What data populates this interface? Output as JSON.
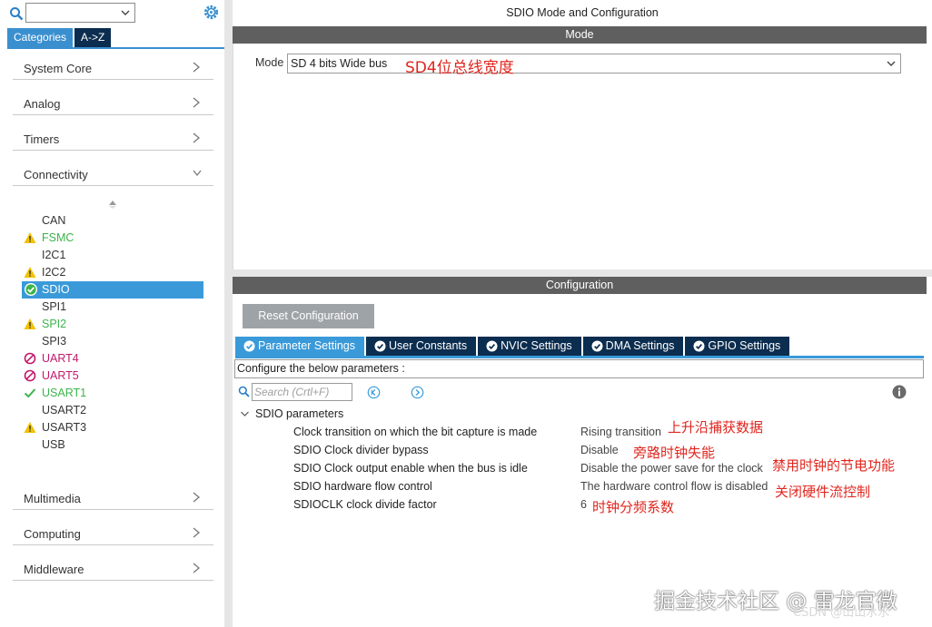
{
  "left": {
    "tabs": {
      "categories": "Categories",
      "atoz": "A->Z"
    },
    "categories": [
      {
        "label": "System Core"
      },
      {
        "label": "Analog"
      },
      {
        "label": "Timers"
      },
      {
        "label": "Connectivity"
      },
      {
        "label": "Multimedia"
      },
      {
        "label": "Computing"
      },
      {
        "label": "Middleware"
      }
    ],
    "peripherals": [
      {
        "label": "CAN",
        "status": "none",
        "color": "#333333"
      },
      {
        "label": "FSMC",
        "status": "warning",
        "color": "#3cb44b"
      },
      {
        "label": "I2C1",
        "status": "none",
        "color": "#333333"
      },
      {
        "label": "I2C2",
        "status": "warning",
        "color": "#333333"
      },
      {
        "label": "SDIO",
        "status": "ok",
        "color": "#ffffff"
      },
      {
        "label": "SPI1",
        "status": "none",
        "color": "#333333"
      },
      {
        "label": "SPI2",
        "status": "warning",
        "color": "#3cb44b"
      },
      {
        "label": "SPI3",
        "status": "none",
        "color": "#333333"
      },
      {
        "label": "UART4",
        "status": "blocked",
        "color": "#c0186b"
      },
      {
        "label": "UART5",
        "status": "blocked",
        "color": "#c0186b"
      },
      {
        "label": "USART1",
        "status": "ok",
        "color": "#3cb44b"
      },
      {
        "label": "USART2",
        "status": "none",
        "color": "#333333"
      },
      {
        "label": "USART3",
        "status": "warning",
        "color": "#333333"
      },
      {
        "label": "USB",
        "status": "none",
        "color": "#333333"
      }
    ]
  },
  "main": {
    "title": "SDIO Mode and Configuration",
    "mode_header": "Mode",
    "mode_label": "Mode",
    "mode_value": "SD 4 bits Wide bus",
    "mode_annotation": "SD4位总线宽度",
    "config_header": "Configuration",
    "reset_button": "Reset Configuration",
    "tabs": [
      {
        "label": "Parameter Settings"
      },
      {
        "label": "User Constants"
      },
      {
        "label": "NVIC Settings"
      },
      {
        "label": "DMA Settings"
      },
      {
        "label": "GPIO Settings"
      }
    ],
    "description": "Configure the below parameters :",
    "search_placeholder": "Search (Crtl+F)",
    "group_title": "SDIO parameters",
    "params": [
      {
        "name": "Clock transition on which the bit capture is made",
        "value": "Rising transition",
        "note": "上升沿捕获数据"
      },
      {
        "name": "SDIO Clock divider bypass",
        "value": "Disable",
        "note": "旁路时钟失能"
      },
      {
        "name": "SDIO Clock output enable when the bus is idle",
        "value": "Disable the power save for the clock",
        "note": "禁用时钟的节电功能"
      },
      {
        "name": "SDIO hardware flow control",
        "value": "The hardware control flow is disabled",
        "note": "关闭硬件流控制"
      },
      {
        "name": "SDIOCLK clock divide factor",
        "value": "6",
        "note": "时钟分频系数"
      }
    ]
  },
  "watermark": {
    "text": "掘金技术社区 @ 雷龙官微",
    "sub": "CSDN @山山水水"
  },
  "colors": {
    "accent": "#3a9ad9",
    "dark_tab": "#0b2d4f",
    "header_bar": "#5f5f5f",
    "annotation": "#e0261e"
  }
}
